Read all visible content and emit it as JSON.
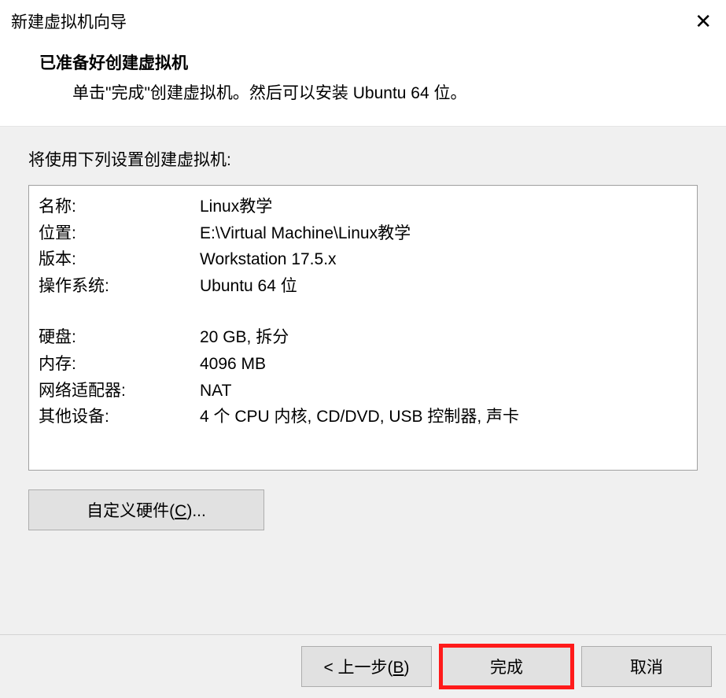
{
  "window": {
    "title": "新建虚拟机向导"
  },
  "header": {
    "title": "已准备好创建虚拟机",
    "subtitle": "单击\"完成\"创建虚拟机。然后可以安装 Ubuntu 64 位。"
  },
  "section_label": "将使用下列设置创建虚拟机:",
  "summary": {
    "rows1": [
      {
        "label": "名称:",
        "value": "Linux教学"
      },
      {
        "label": "位置:",
        "value": "E:\\Virtual Machine\\Linux教学"
      },
      {
        "label": "版本:",
        "value": "Workstation 17.5.x"
      },
      {
        "label": "操作系统:",
        "value": "Ubuntu 64 位"
      }
    ],
    "rows2": [
      {
        "label": "硬盘:",
        "value": "20 GB, 拆分"
      },
      {
        "label": "内存:",
        "value": "4096 MB"
      },
      {
        "label": "网络适配器:",
        "value": "NAT"
      },
      {
        "label": "其他设备:",
        "value": "4 个 CPU 内核, CD/DVD, USB 控制器, 声卡"
      }
    ]
  },
  "buttons": {
    "customize_prefix": "自定义硬件(",
    "customize_hotkey": "C",
    "customize_suffix": ")...",
    "back_prefix": "< 上一步(",
    "back_hotkey": "B",
    "back_suffix": ")",
    "finish": "完成",
    "cancel": "取消"
  }
}
